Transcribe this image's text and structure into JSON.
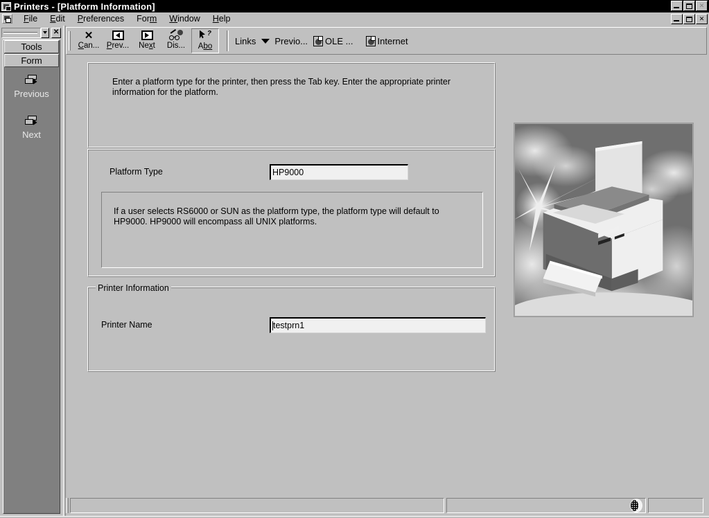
{
  "window": {
    "title": "Printers - [Platform Information]",
    "icon": "printers-app-icon",
    "controls": {
      "minimize": "_",
      "restore": "restore",
      "close": "✕"
    }
  },
  "menubar": {
    "system_icon": "system-menu-icon",
    "items": [
      {
        "label": "File",
        "mnemonic": "F"
      },
      {
        "label": "Edit",
        "mnemonic": "E"
      },
      {
        "label": "Preferences",
        "mnemonic": "P"
      },
      {
        "label": "Form",
        "mnemonic": "m"
      },
      {
        "label": "Window",
        "mnemonic": "W"
      },
      {
        "label": "Help",
        "mnemonic": "H"
      }
    ]
  },
  "sidebar": {
    "combo_value": "",
    "close_label": "✕",
    "tabs": [
      {
        "label": "Tools",
        "selected": false
      },
      {
        "label": "Form",
        "selected": true
      }
    ],
    "entries": [
      {
        "label": "Previous",
        "icon": "previous-record-icon"
      },
      {
        "label": "Next",
        "icon": "next-record-icon"
      }
    ]
  },
  "toolbar": {
    "buttons": [
      {
        "label": "Can...",
        "icon": "cancel-x-icon",
        "mnemonic": "C",
        "pressed": false
      },
      {
        "label": "Prev...",
        "icon": "previous-arrow-icon",
        "mnemonic": "P",
        "pressed": false
      },
      {
        "label": "Next",
        "icon": "next-arrow-icon",
        "mnemonic": "x",
        "pressed": false
      },
      {
        "label": "Dis...",
        "icon": "display-glasses-icon",
        "mnemonic": "",
        "pressed": false
      },
      {
        "label": "Abo",
        "icon": "about-help-pointer-icon",
        "mnemonic": "bo",
        "pressed": true
      }
    ],
    "links_label": "Links",
    "links_dropdown_icon": "chevron-down-icon",
    "link_items": [
      {
        "label": "Previo...",
        "icon": ""
      },
      {
        "label": "OLE ...",
        "icon": "ole-document-icon"
      },
      {
        "label": "Internet",
        "icon": "internet-document-icon"
      }
    ]
  },
  "main": {
    "info_panel": {
      "text": "Enter a platform type for the printer, then press the Tab key.  Enter the appropriate printer information for the platform."
    },
    "platform_panel": {
      "field_label": "Platform Type",
      "field_value": "HP9000",
      "field_placeholder": "",
      "note": "If a user selects RS6000 or SUN as the platform type, the platform type will default to HP9000. HP9000 will encompass all UNIX platforms."
    },
    "printer_panel": {
      "group_title": "Printer Information",
      "field_label": "Printer Name",
      "field_value": "testprn1",
      "field_placeholder": ""
    },
    "picture": {
      "name": "printer-illustration",
      "alt": "Laser printer with paper and starburst"
    }
  },
  "statusbar": {
    "pane1": "",
    "pane2": "",
    "pane3": "",
    "globe_icon": "globe-icon"
  },
  "colors": {
    "face": "#c0c0c0",
    "sidebar": "#808080",
    "field": "#f0f0f0",
    "titlebar": "#000000",
    "titlebar_text": "#ffffff",
    "picture_bg": "#787878"
  }
}
